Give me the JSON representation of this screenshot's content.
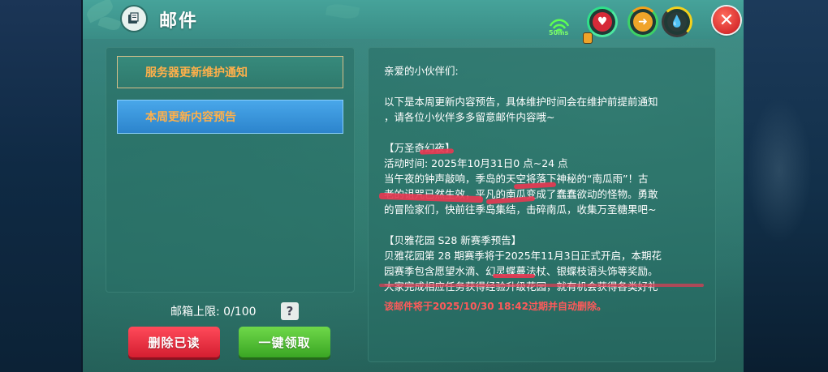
{
  "window": {
    "title": "邮件"
  },
  "status": {
    "network": "50ms"
  },
  "mail_list": {
    "items": [
      {
        "label": "服务器更新维护通知"
      },
      {
        "label": "本周更新内容预告"
      }
    ]
  },
  "mailbox": {
    "limit_label": "邮箱上限: 0/100",
    "help": "?"
  },
  "buttons": {
    "delete_read": "删除已读",
    "claim_all": "一键领取",
    "close": "✕"
  },
  "content": {
    "greeting": "亲爱的小伙伴们:",
    "intro_1": "以下是本周更新内容预告，具体维护时间会在维护前提前通知",
    "intro_2": "，请各位小伙伴多多留意邮件内容哦~",
    "section1_title": "【万圣奇幻夜】",
    "section1_time": "活动时间: 2025年10月31日0 点~24 点",
    "section1_line1": "当午夜的钟声敲响，季岛的天空将落下神秘的“南瓜雨”！古",
    "section1_line2": "老的诅咒已然生效，平凡的南瓜变成了蠢蠢欲动的怪物。勇敢",
    "section1_line3": "的冒险家们，快前往季岛集结，击碎南瓜，收集万圣糖果吧~",
    "section2_title": "【贝雅花园 S28 新赛季预告】",
    "section2_line1": "贝雅花园第 28 期赛季将于2025年11月3日正式开启，本期花",
    "section2_line2": "园赛季包含愿望水滴、幻灵蝶蔓法杖、银蝶枝语头饰等奖励。",
    "section2_line3": "大家完成相应任务获得经验升级花园，就有机会获得各类好礼",
    "expiry_note": "该邮件将于2025/10/30 18:42过期并自动删除。"
  }
}
